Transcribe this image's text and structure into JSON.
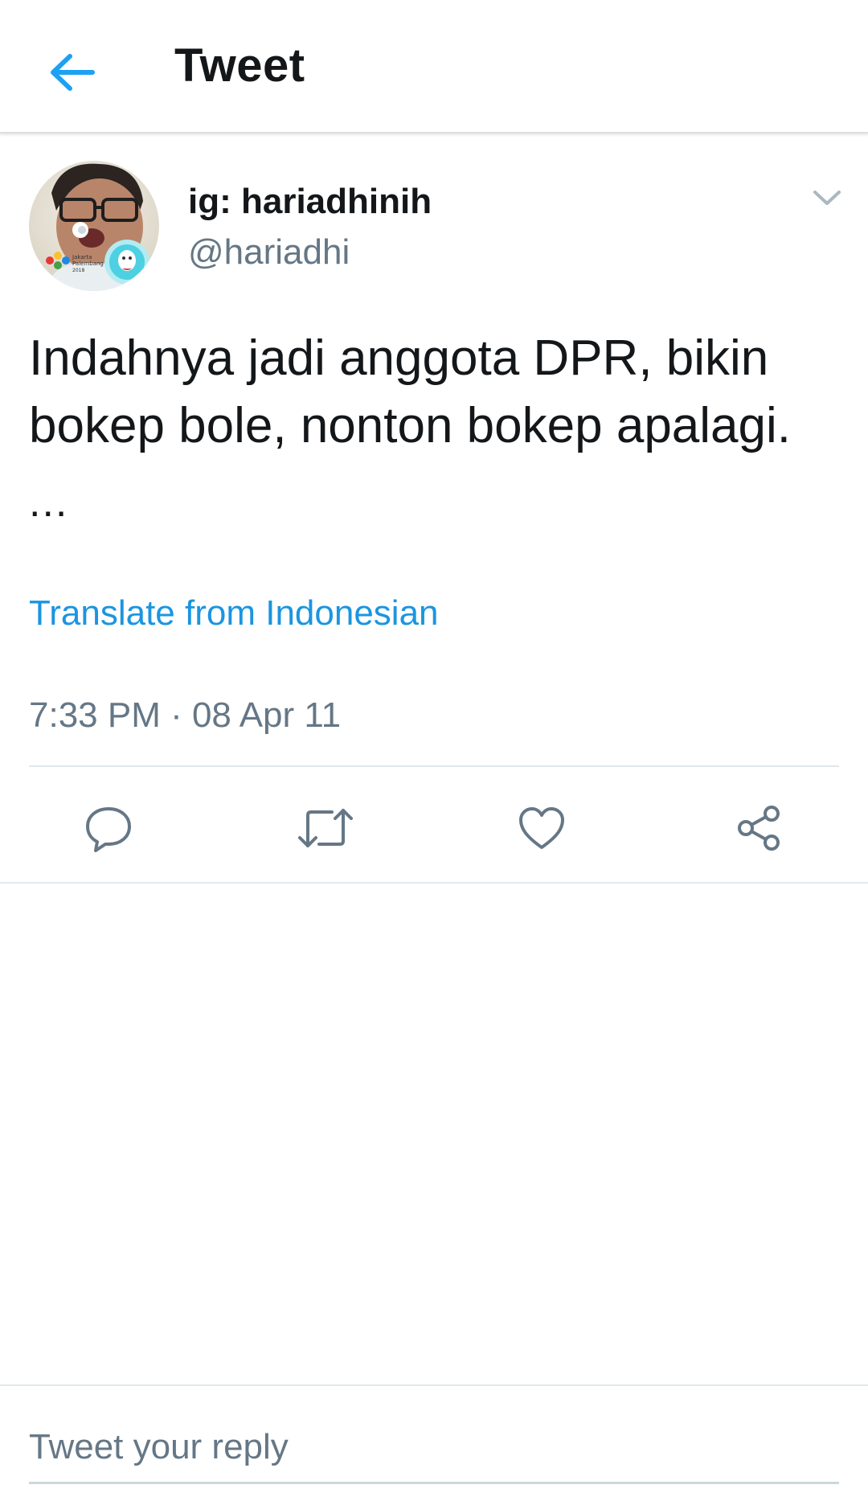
{
  "header": {
    "title": "Tweet",
    "back_icon": "arrow-left-icon",
    "accent_color": "#1da1f2"
  },
  "tweet": {
    "author": {
      "display_name": "ig: hariadhinih",
      "handle": "@hariadhi",
      "avatar_badge_text": "Jakarta Palembang 2018"
    },
    "text": "Indahnya jadi anggota DPR, bikin bokep bole, nonton bokep apalagi.",
    "ellipsis": "...",
    "translate_label": "Translate from Indonesian",
    "timestamp": "7:33 PM · 08 Apr 11",
    "menu_icon": "chevron-down-icon"
  },
  "actions": [
    {
      "name": "reply",
      "icon": "reply-icon"
    },
    {
      "name": "retweet",
      "icon": "retweet-icon"
    },
    {
      "name": "like",
      "icon": "heart-icon"
    },
    {
      "name": "share",
      "icon": "share-icon"
    }
  ],
  "reply_bar": {
    "placeholder": "Tweet your reply"
  },
  "colors": {
    "text_primary": "#14171a",
    "text_secondary": "#657786",
    "link": "#1b95e0",
    "divider": "#e1e8ed"
  }
}
